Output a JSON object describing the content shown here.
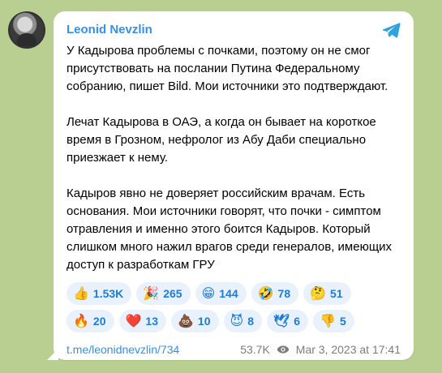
{
  "channel": {
    "author": "Leonid Nevzlin",
    "paragraphs": [
      "У Кадырова проблемы с почками, поэтому он не смог присутствовать на послании Путина Федеральному собранию, пишет Bild. Мои источники это подтверждают.",
      "Лечат Кадырова в ОАЭ, а когда он бывает на короткое время в Грозном, нефролог из Абу Даби специально приезжает к нему.",
      "Кадыров явно не доверяет российским врачам. Есть основания. Мои источники говорят, что почки - симптом отравления и именно этого боится Кадыров. Который слишком много нажил врагов среди генералов, имеющих доступ к разработкам ГРУ"
    ],
    "reactions": [
      {
        "emoji": "👍",
        "count": "1.53K"
      },
      {
        "emoji": "🎉",
        "count": "265"
      },
      {
        "emoji": "😁",
        "count": "144"
      },
      {
        "emoji": "🤣",
        "count": "78"
      },
      {
        "emoji": "🤔",
        "count": "51"
      },
      {
        "emoji": "🔥",
        "count": "20"
      },
      {
        "emoji": "❤️",
        "count": "13"
      },
      {
        "emoji": "💩",
        "count": "10"
      },
      {
        "emoji": "😈",
        "count": "8"
      },
      {
        "emoji": "🕊",
        "count": "6"
      },
      {
        "emoji": "👎",
        "count": "5"
      }
    ],
    "footer": {
      "link": "t.me/leonidnevzlin/734",
      "views": "53.7K",
      "timestamp": "Mar 3, 2023 at 17:41"
    },
    "icons": {
      "telegram": "telegram-icon",
      "eye": "eye-icon"
    },
    "colors": {
      "accent": "#3390ec",
      "reaction_bg": "#e9f2fc",
      "bubble": "#ffffff"
    }
  }
}
